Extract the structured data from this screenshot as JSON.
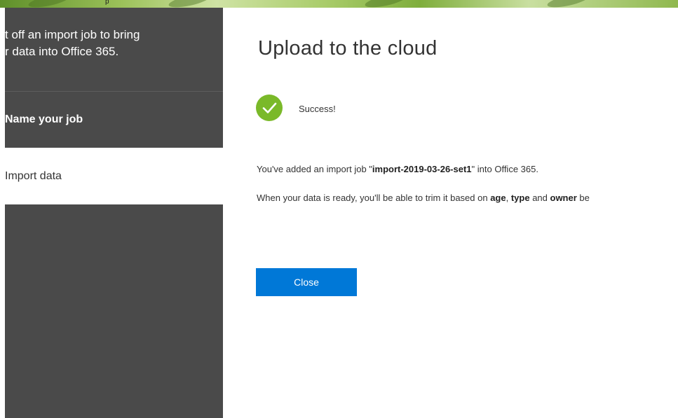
{
  "banner": {
    "fragment": "p"
  },
  "sidebar": {
    "intro_line1": "t off an import job to bring",
    "intro_line2": "r data into Office 365.",
    "steps": [
      {
        "label": "Name your job"
      },
      {
        "label": "Import data"
      }
    ]
  },
  "main": {
    "title": "Upload to the cloud",
    "status": {
      "icon": "check-circle-icon",
      "text": "Success!",
      "color": "#7ab929"
    },
    "message1": {
      "prefix": "You've added an import job \"",
      "job_name": "import-2019-03-26-set1",
      "suffix": "\" into Office 365."
    },
    "message2": {
      "prefix": "When your data is ready, you'll be able to trim it based on ",
      "term1": "age",
      "sep1": ", ",
      "term2": "type",
      "sep2": " and ",
      "term3": "owner",
      "suffix": " be"
    },
    "close_label": "Close"
  },
  "colors": {
    "sidebar_bg": "#4a4a4a",
    "primary_button": "#0078d7",
    "success": "#7ab929"
  }
}
